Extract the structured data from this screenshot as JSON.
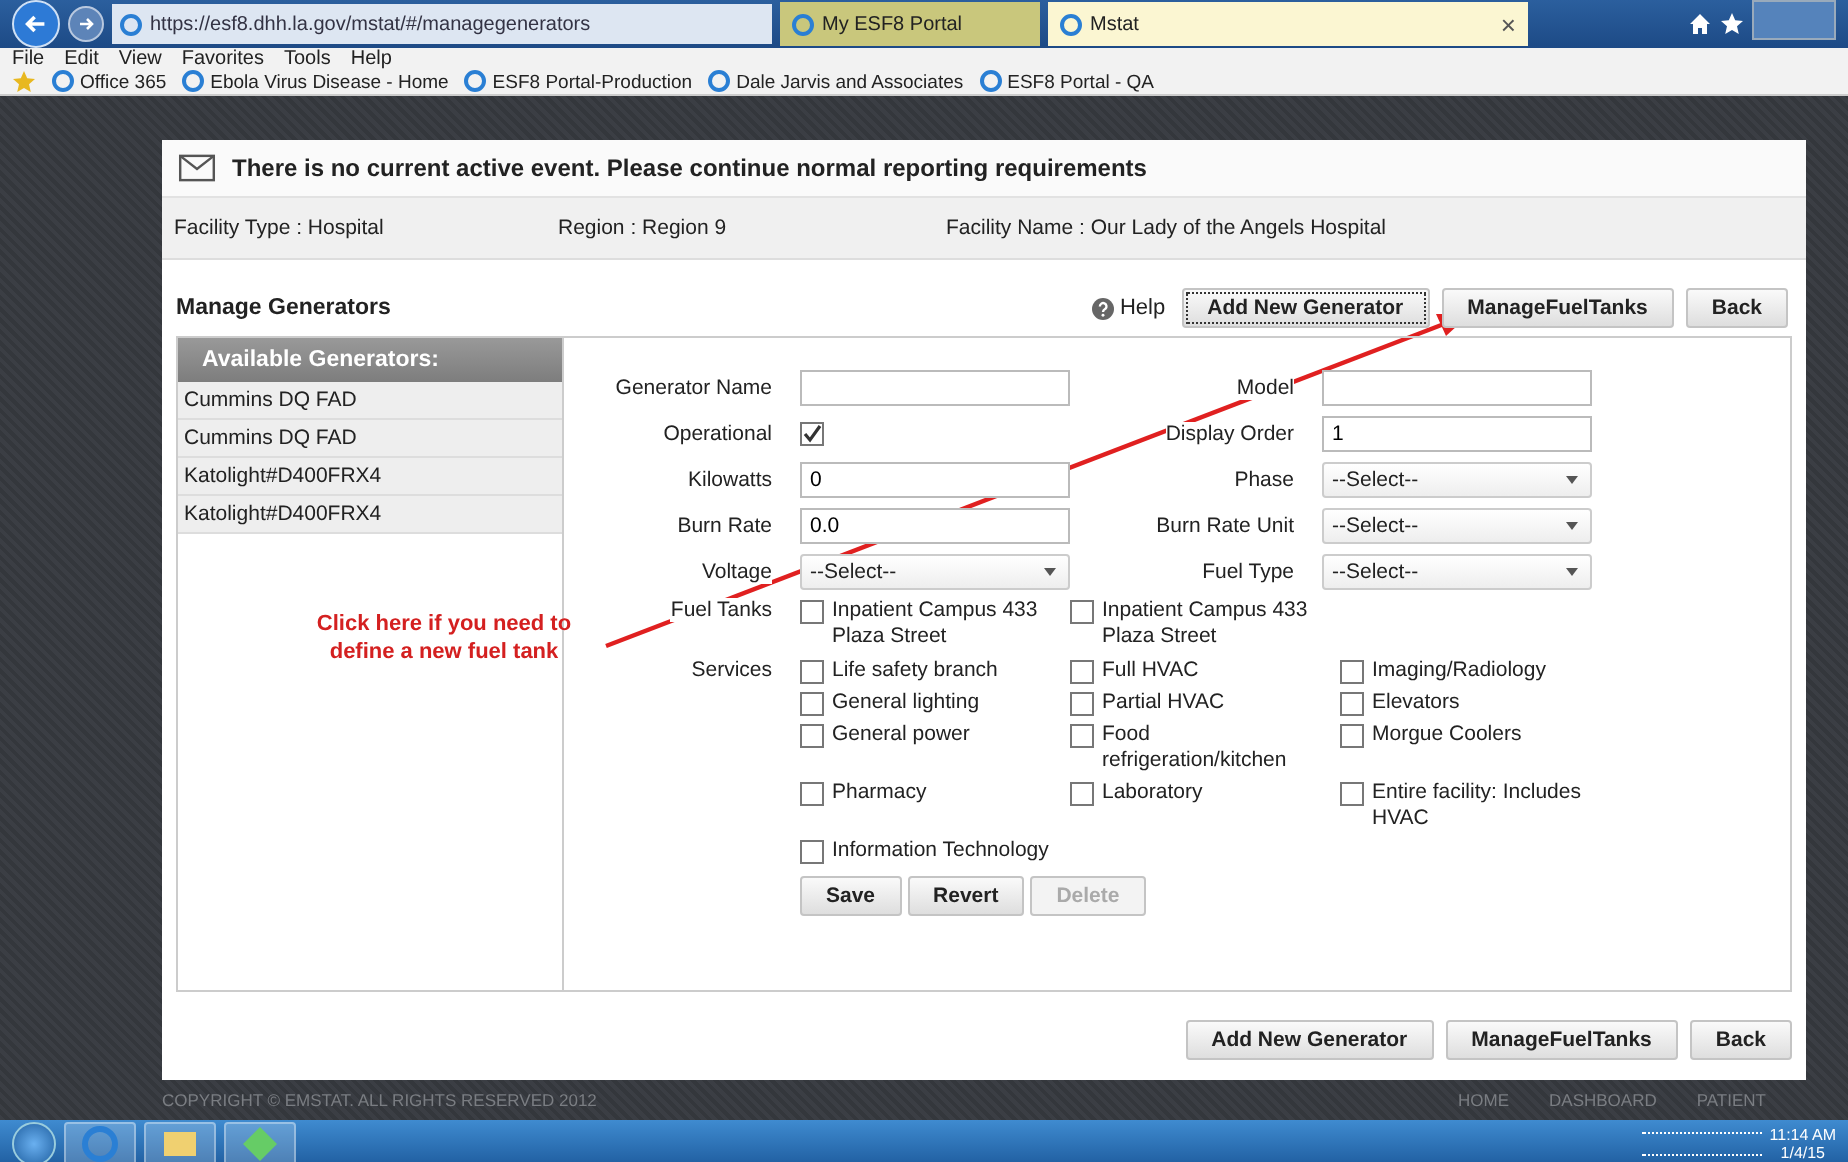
{
  "browser": {
    "address": "https://esf8.dhh.la.gov/mstat/#/managegenerators",
    "tabs": [
      {
        "label": "My ESF8 Portal",
        "selected": false
      },
      {
        "label": "Mstat",
        "selected": true
      }
    ],
    "close_tab": "×",
    "menu": [
      "File",
      "Edit",
      "View",
      "Favorites",
      "Tools",
      "Help"
    ],
    "favorites": [
      "Office 365",
      "Ebola Virus Disease - Home",
      "ESF8 Portal-Production",
      "Dale Jarvis and Associates",
      "ESF8 Portal - QA"
    ]
  },
  "banner": "There is no current active event. Please continue normal reporting requirements",
  "facility": [
    "Facility Type : Hospital",
    "Region : Region 9",
    "Facility Name : Our Lady of the Angels Hospital"
  ],
  "page_title": "Manage Generators",
  "help": "Help",
  "top_buttons": [
    "Add New Generator",
    "ManageFuelTanks",
    "Back"
  ],
  "sidebar": {
    "heading": "Available Generators:",
    "items": [
      "Cummins DQ FAD",
      "Cummins DQ FAD",
      "Katolight#D400FRX4",
      "Katolight#D400FRX4"
    ]
  },
  "fields": [
    {
      "label": "Generator Name",
      "kind": "text"
    },
    {
      "label": "Model",
      "kind": "text"
    },
    {
      "label": "Operational",
      "kind": "checkbox",
      "checked": true
    },
    {
      "label": "Display Order",
      "kind": "text",
      "value": "1"
    },
    {
      "label": "Kilowatts",
      "kind": "text",
      "value": "0"
    },
    {
      "label": "Phase",
      "kind": "select",
      "value": "--Select--"
    },
    {
      "label": "Burn Rate",
      "kind": "text",
      "value": "0.0"
    },
    {
      "label": "Burn Rate Unit",
      "kind": "select",
      "value": "--Select--"
    },
    {
      "label": "Voltage",
      "kind": "select",
      "value": "--Select--"
    },
    {
      "label": "Fuel Type",
      "kind": "select",
      "value": "--Select--"
    }
  ],
  "fuel_tanks": {
    "label": "Fuel Tanks",
    "items": [
      {
        "label": "Inpatient Campus 433 Plaza Street",
        "checked": false
      },
      {
        "label": "Inpatient Campus 433 Plaza Street",
        "checked": false
      }
    ]
  },
  "services": {
    "label": "Services",
    "items": [
      {
        "label": "Life safety branch",
        "checked": false
      },
      {
        "label": "Full HVAC",
        "checked": false
      },
      {
        "label": "Imaging/Radiology",
        "checked": false
      },
      {
        "label": "General lighting",
        "checked": false
      },
      {
        "label": "Partial HVAC",
        "checked": false
      },
      {
        "label": "Elevators",
        "checked": false
      },
      {
        "label": "General power",
        "checked": false
      },
      {
        "label": "Food refrigeration/kitchen",
        "checked": false
      },
      {
        "label": "Morgue Coolers",
        "checked": false
      },
      {
        "label": "Pharmacy",
        "checked": false
      },
      {
        "label": "Laboratory",
        "checked": false
      },
      {
        "label": "Entire facility: Includes HVAC",
        "checked": false
      },
      {
        "label": "Information Technology",
        "checked": false
      }
    ]
  },
  "form_buttons": [
    {
      "label": "Save",
      "disabled": false
    },
    {
      "label": "Revert",
      "disabled": false
    },
    {
      "label": "Delete",
      "disabled": true
    }
  ],
  "annotation": "Click here if you need to define a new fuel tank",
  "bottom_buttons": [
    "Add New Generator",
    "ManageFuelTanks",
    "Back"
  ],
  "footer": {
    "copyright": "COPYRIGHT © EMSTAT. ALL RIGHTS RESERVED 2012",
    "links": [
      "HOME",
      "DASHBOARD",
      "PATIENT"
    ]
  },
  "taskbar": {
    "time": "11:14 AM",
    "date": "1/4/15"
  }
}
